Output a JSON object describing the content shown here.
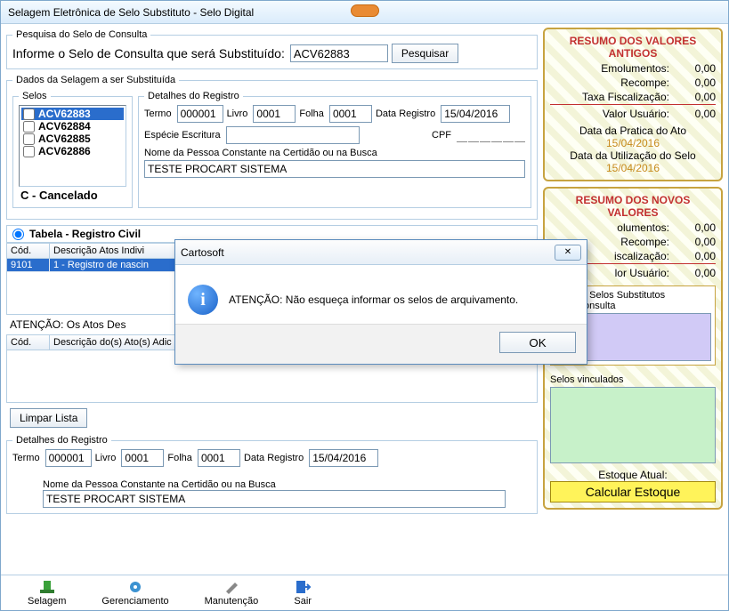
{
  "window": {
    "title": "Selagem Eletrônica de Selo Substituto - Selo Digital"
  },
  "pesquisa": {
    "legend": "Pesquisa do Selo de Consulta",
    "label": "Informe o Selo de Consulta que será Substituído:",
    "value": "ACV62883",
    "button": "Pesquisar"
  },
  "dados": {
    "legend": "Dados da Selagem a ser Substituída",
    "selos_legend": "Selos",
    "items": [
      {
        "code": "ACV62883",
        "selected": true
      },
      {
        "code": "ACV62884",
        "selected": false
      },
      {
        "code": "ACV62885",
        "selected": false
      },
      {
        "code": "ACV62886",
        "selected": false
      }
    ],
    "cancelado": "C - Cancelado",
    "detalhes_legend": "Detalhes do Registro",
    "termo_label": "Termo",
    "termo": "000001",
    "livro_label": "Livro",
    "livro": "0001",
    "folha_label": "Folha",
    "folha": "0001",
    "data_label": "Data Registro",
    "data": "15/04/2016",
    "especie_label": "Espécie Escritura",
    "especie": "",
    "cpf_label": "CPF",
    "nome_label": "Nome da Pessoa Constante na Certidão ou na Busca",
    "nome": "TESTE PROCART SISTEMA"
  },
  "tabela": {
    "radio_label": "Tabela - Registro Civil",
    "col_cod": "Cód.",
    "col_desc": "Descrição Atos Indivi",
    "rows": [
      {
        "cod": "9101",
        "desc": "1 - Registro de nascin"
      }
    ]
  },
  "atencao_atos": {
    "label": "ATENÇÃO: Os Atos Des",
    "col_cod": "Cód.",
    "col_desc": "Descrição do(s) Ato(s) Adic"
  },
  "limpar": "Limpar Lista",
  "detalhes2": {
    "legend": "Detalhes do Registro",
    "termo_label": "Termo",
    "termo": "000001",
    "livro_label": "Livro",
    "livro": "0001",
    "folha_label": "Folha",
    "folha": "0001",
    "data_label": "Data Registro",
    "data": "15/04/2016",
    "nome_label": "Nome da Pessoa Constante na Certidão ou na Busca",
    "nome": "TESTE PROCART SISTEMA"
  },
  "resumo_antigo": {
    "title": "RESUMO DOS VALORES ANTIGOS",
    "emolumentos_k": "Emolumentos:",
    "emolumentos_v": "0,00",
    "recompe_k": "Recompe:",
    "recompe_v": "0,00",
    "taxa_k": "Taxa Fiscalização:",
    "taxa_v": "0,00",
    "usuario_k": "Valor Usuário:",
    "usuario_v": "0,00",
    "pratica_lbl": "Data da Pratica do Ato",
    "pratica_val": "15/04/2016",
    "utiliz_lbl": "Data da Utilização do Selo",
    "utiliz_val": "15/04/2016"
  },
  "resumo_novo": {
    "title": "RESUMO DOS NOVOS VALORES",
    "emolumentos_k": "olumentos:",
    "emolumentos_v": "0,00",
    "recompe_k": "Recompe:",
    "recompe_v": "0,00",
    "taxa_k": "iscalização:",
    "taxa_v": "0,00",
    "usuario_k": "lor Usuário:",
    "usuario_v": "0,00",
    "subst_hdr": "em dos Selos Substitutos\npara Consulta",
    "vinc_hdr": "Selos vinculados",
    "estoque_lbl": "Estoque Atual:",
    "calc_btn": "Calcular Estoque"
  },
  "toolbar": {
    "selagem": "Selagem",
    "gerenc": "Gerenciamento",
    "manut": "Manutenção",
    "sair": "Sair"
  },
  "dialog": {
    "title": "Cartosoft",
    "message": "ATENÇÃO: Não esqueça informar os selos de arquivamento.",
    "ok": "OK"
  }
}
